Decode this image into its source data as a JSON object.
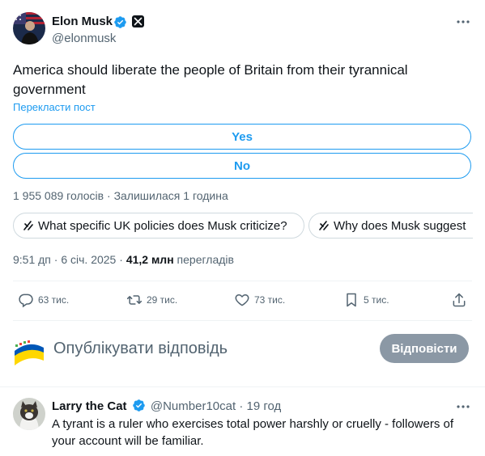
{
  "tweet": {
    "author": {
      "name": "Elon Musk",
      "handle": "@elonmusk"
    },
    "text": "America should liberate the people of Britain from their tyrannical government",
    "translate_label": "Перекласти пост",
    "poll": {
      "options": [
        "Yes",
        "No"
      ],
      "votes": "1 955 089 голосів",
      "separator": " · ",
      "time_left": "Залишилася 1 година"
    },
    "grok_prompts": [
      "What specific UK policies does Musk criticize?",
      "Why does Musk suggest"
    ],
    "timestamp": {
      "time": "9:51 дп",
      "date": "6 січ. 2025",
      "views_count": "41,2 млн",
      "views_label": "перегладів"
    },
    "actions": {
      "replies": "63 тис.",
      "reposts": "29 тис.",
      "likes": "73 тис.",
      "bookmarks": "5 тис."
    }
  },
  "composer": {
    "placeholder": "Опублікувати відповідь",
    "button_label": "Відповісти"
  },
  "reply": {
    "name": "Larry the Cat",
    "handle": "@Number10cat",
    "separator": " · ",
    "time": "19 год",
    "text": "A tyrant is a ruler who exercises total power harshly or cruelly - followers of your account will be familiar."
  },
  "colors": {
    "accent": "#1d9bf0",
    "text": "#0f1419",
    "secondary": "#536471",
    "border": "#cfd9de",
    "button_disabled": "#8b98a5"
  }
}
